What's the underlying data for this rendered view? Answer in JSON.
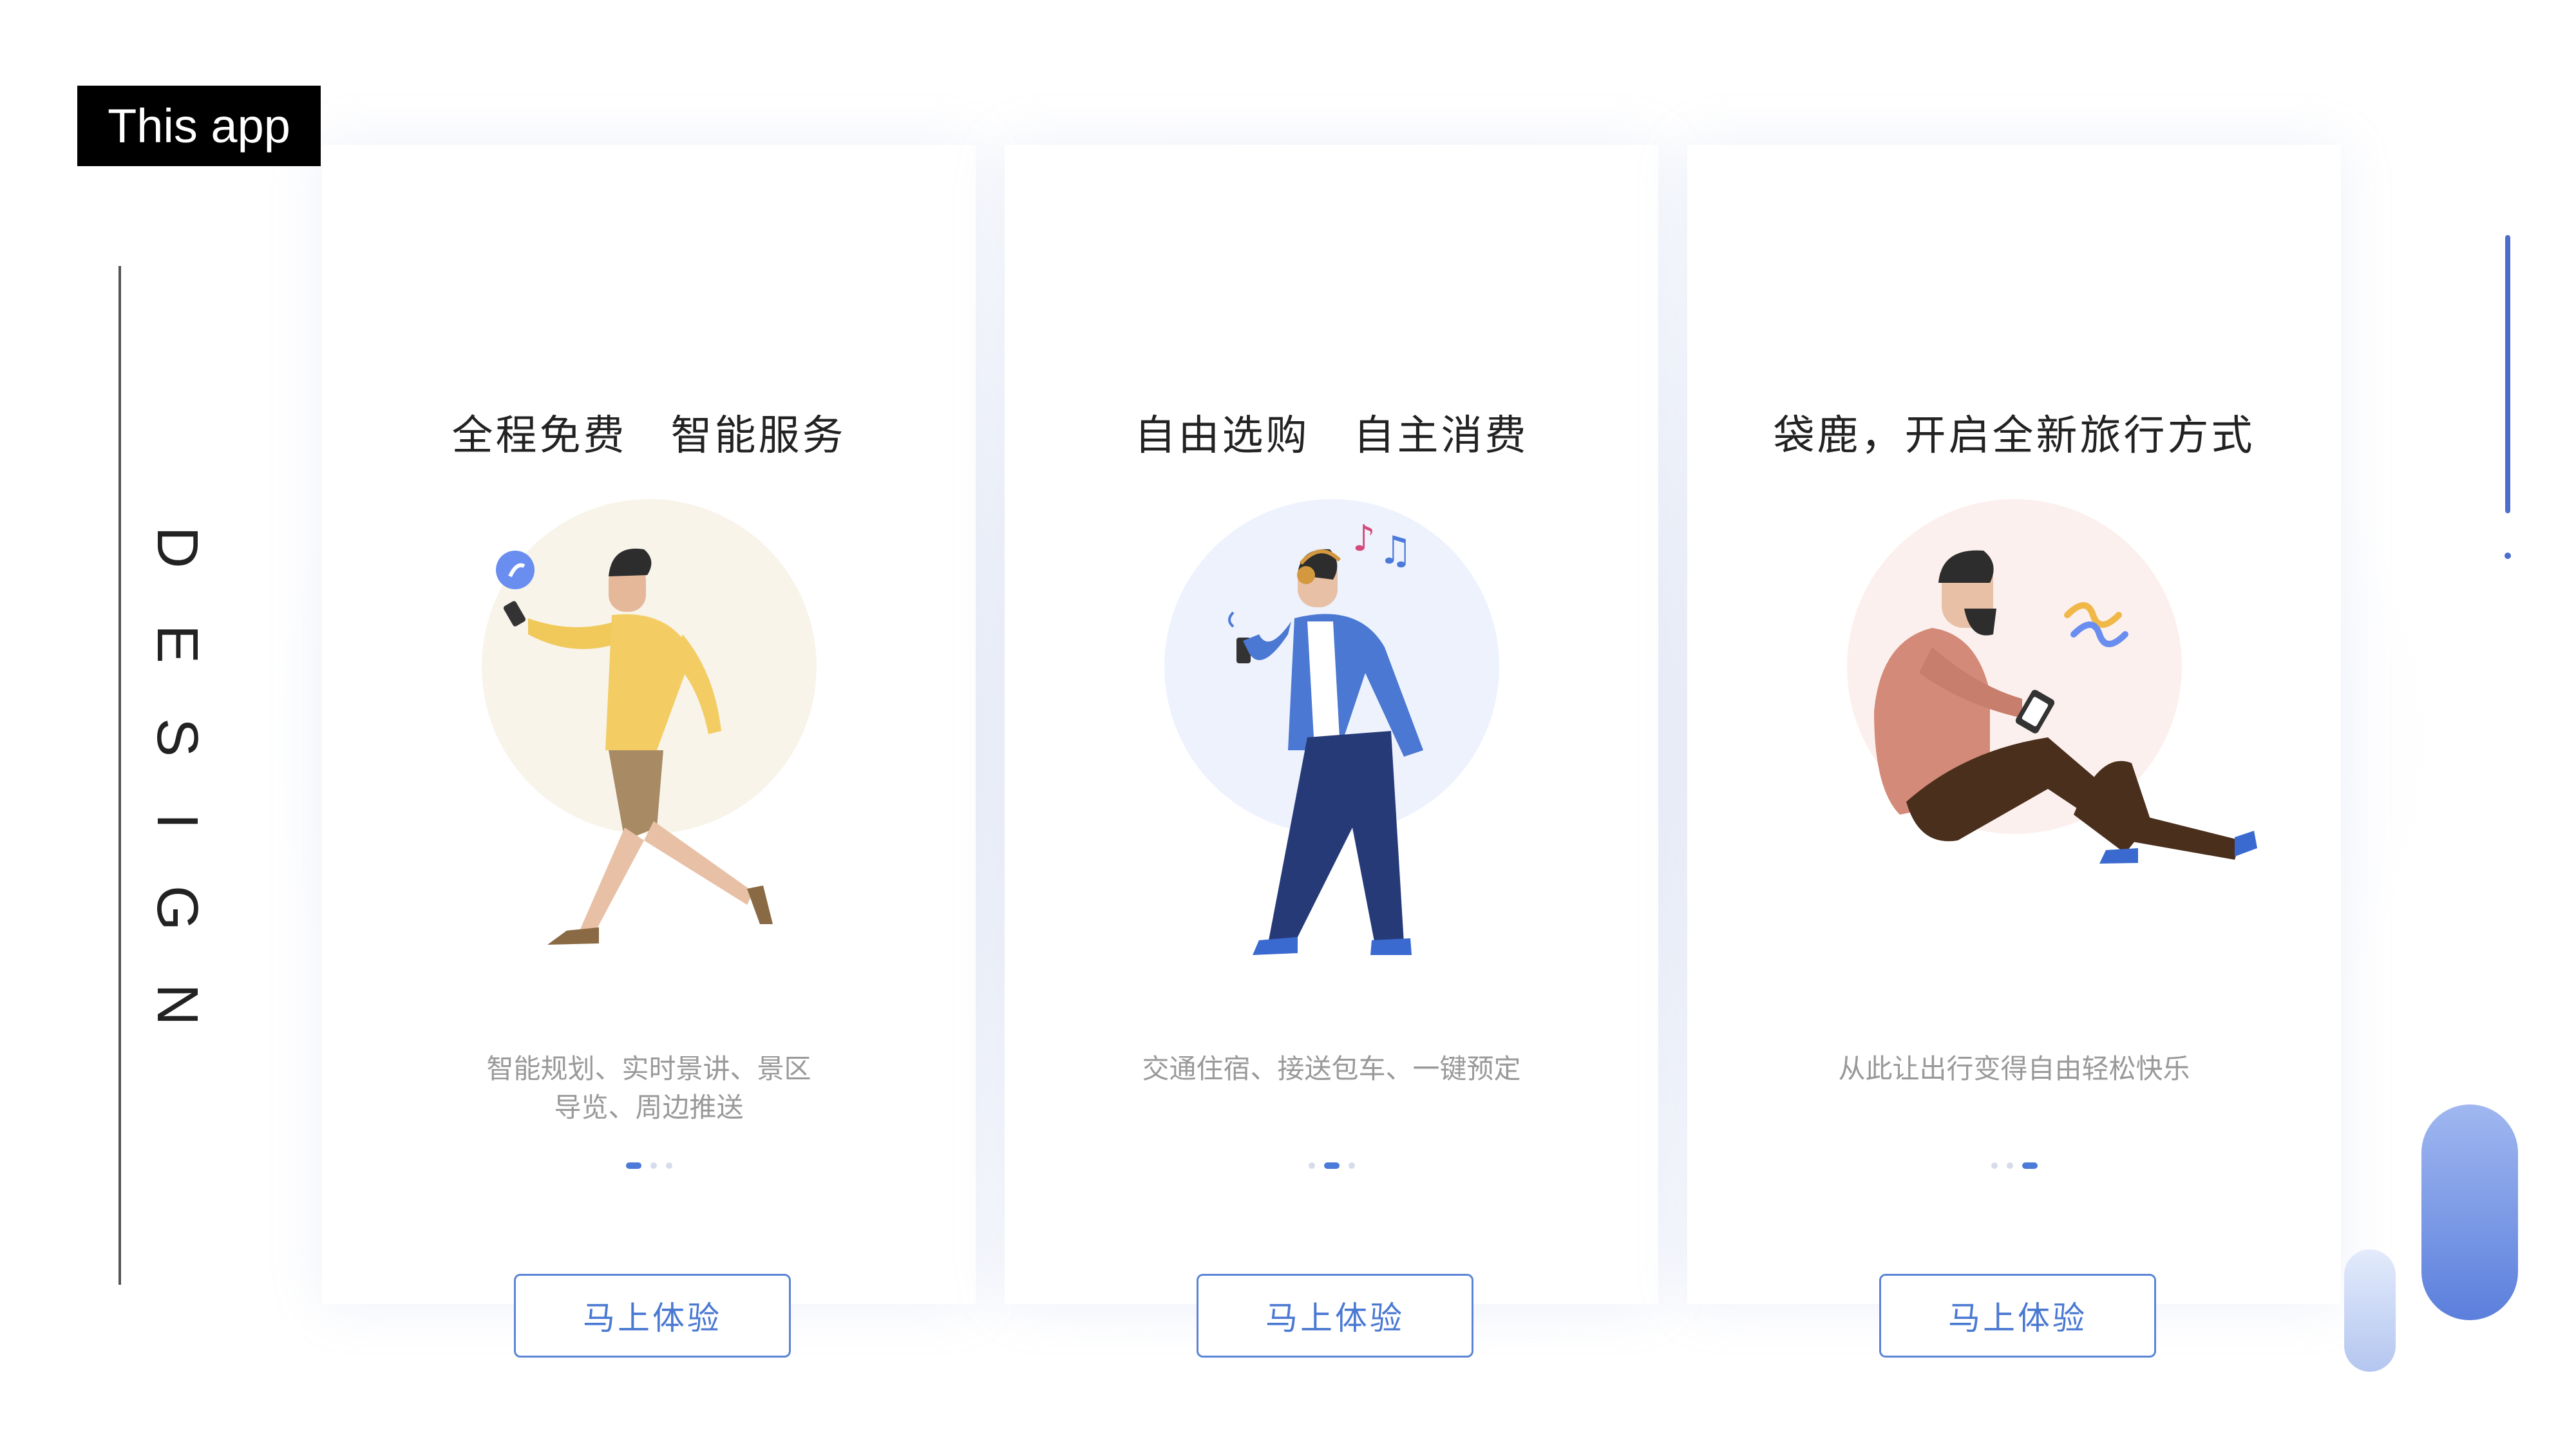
{
  "label": "This app",
  "design_letters": [
    "D",
    "E",
    "S",
    "I",
    "G",
    "N"
  ],
  "colors": {
    "accent": "#4b7ad8",
    "button_text": "#4a79d2",
    "title_text": "#222222",
    "desc_text": "#999999"
  },
  "cards": [
    {
      "title": "全程免费　智能服务",
      "description_lines": [
        "智能规划、实时景讲、景区",
        "导览、周边推送"
      ],
      "active_dot": 0,
      "button_label": "马上体验",
      "illustration": "running-person-with-phone"
    },
    {
      "title": "自由选购　自主消费",
      "description_lines": [
        "交通住宿、接送包车、一键预定"
      ],
      "active_dot": 1,
      "button_label": "马上体验",
      "illustration": "walking-person-with-headphones"
    },
    {
      "title": "袋鹿，开启全新旅行方式",
      "description_lines": [
        "从此让出行变得自由轻松快乐"
      ],
      "active_dot": 2,
      "button_label": "马上体验",
      "illustration": "sitting-person-with-phone"
    }
  ]
}
